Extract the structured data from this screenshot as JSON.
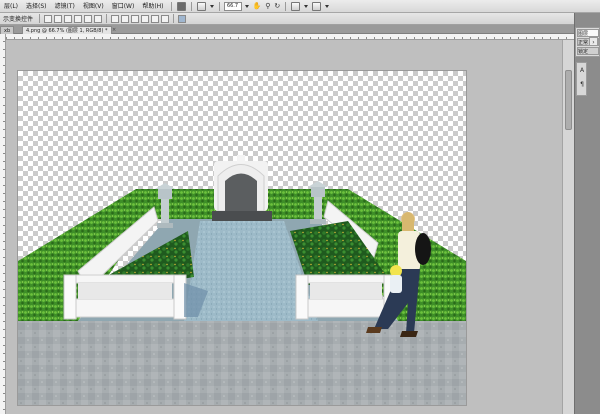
{
  "menubar": {
    "items": [
      "层(L)",
      "选择(S)",
      "滤镜(T)",
      "视图(V)",
      "窗口(W)",
      "帮助(H)"
    ],
    "zoom_value": "66.7"
  },
  "options": {
    "label": "示变换控件"
  },
  "tabs": [
    {
      "label": "xb"
    },
    {
      "label": "4.png @ 66.7% (图层 1, RGB/8) *",
      "close": "×"
    }
  ],
  "panels": {
    "tabs": [
      "图层",
      "正常",
      "锁定"
    ]
  },
  "tools": {
    "items": [
      "A",
      "¶"
    ]
  },
  "colors": {
    "workspace": "#bfbfbf",
    "hedge": "#3f8f2a",
    "railing": "#f4f4f4",
    "path": "#9fbdcb",
    "ground": "#a2a8ab",
    "tombstone": "#5b5e60"
  },
  "icons": [
    "ps-doc-icon",
    "dropdown-icon",
    "hand-icon",
    "zoom-icon",
    "rotate-icon",
    "layout-icon",
    "screen-mode-icon"
  ]
}
